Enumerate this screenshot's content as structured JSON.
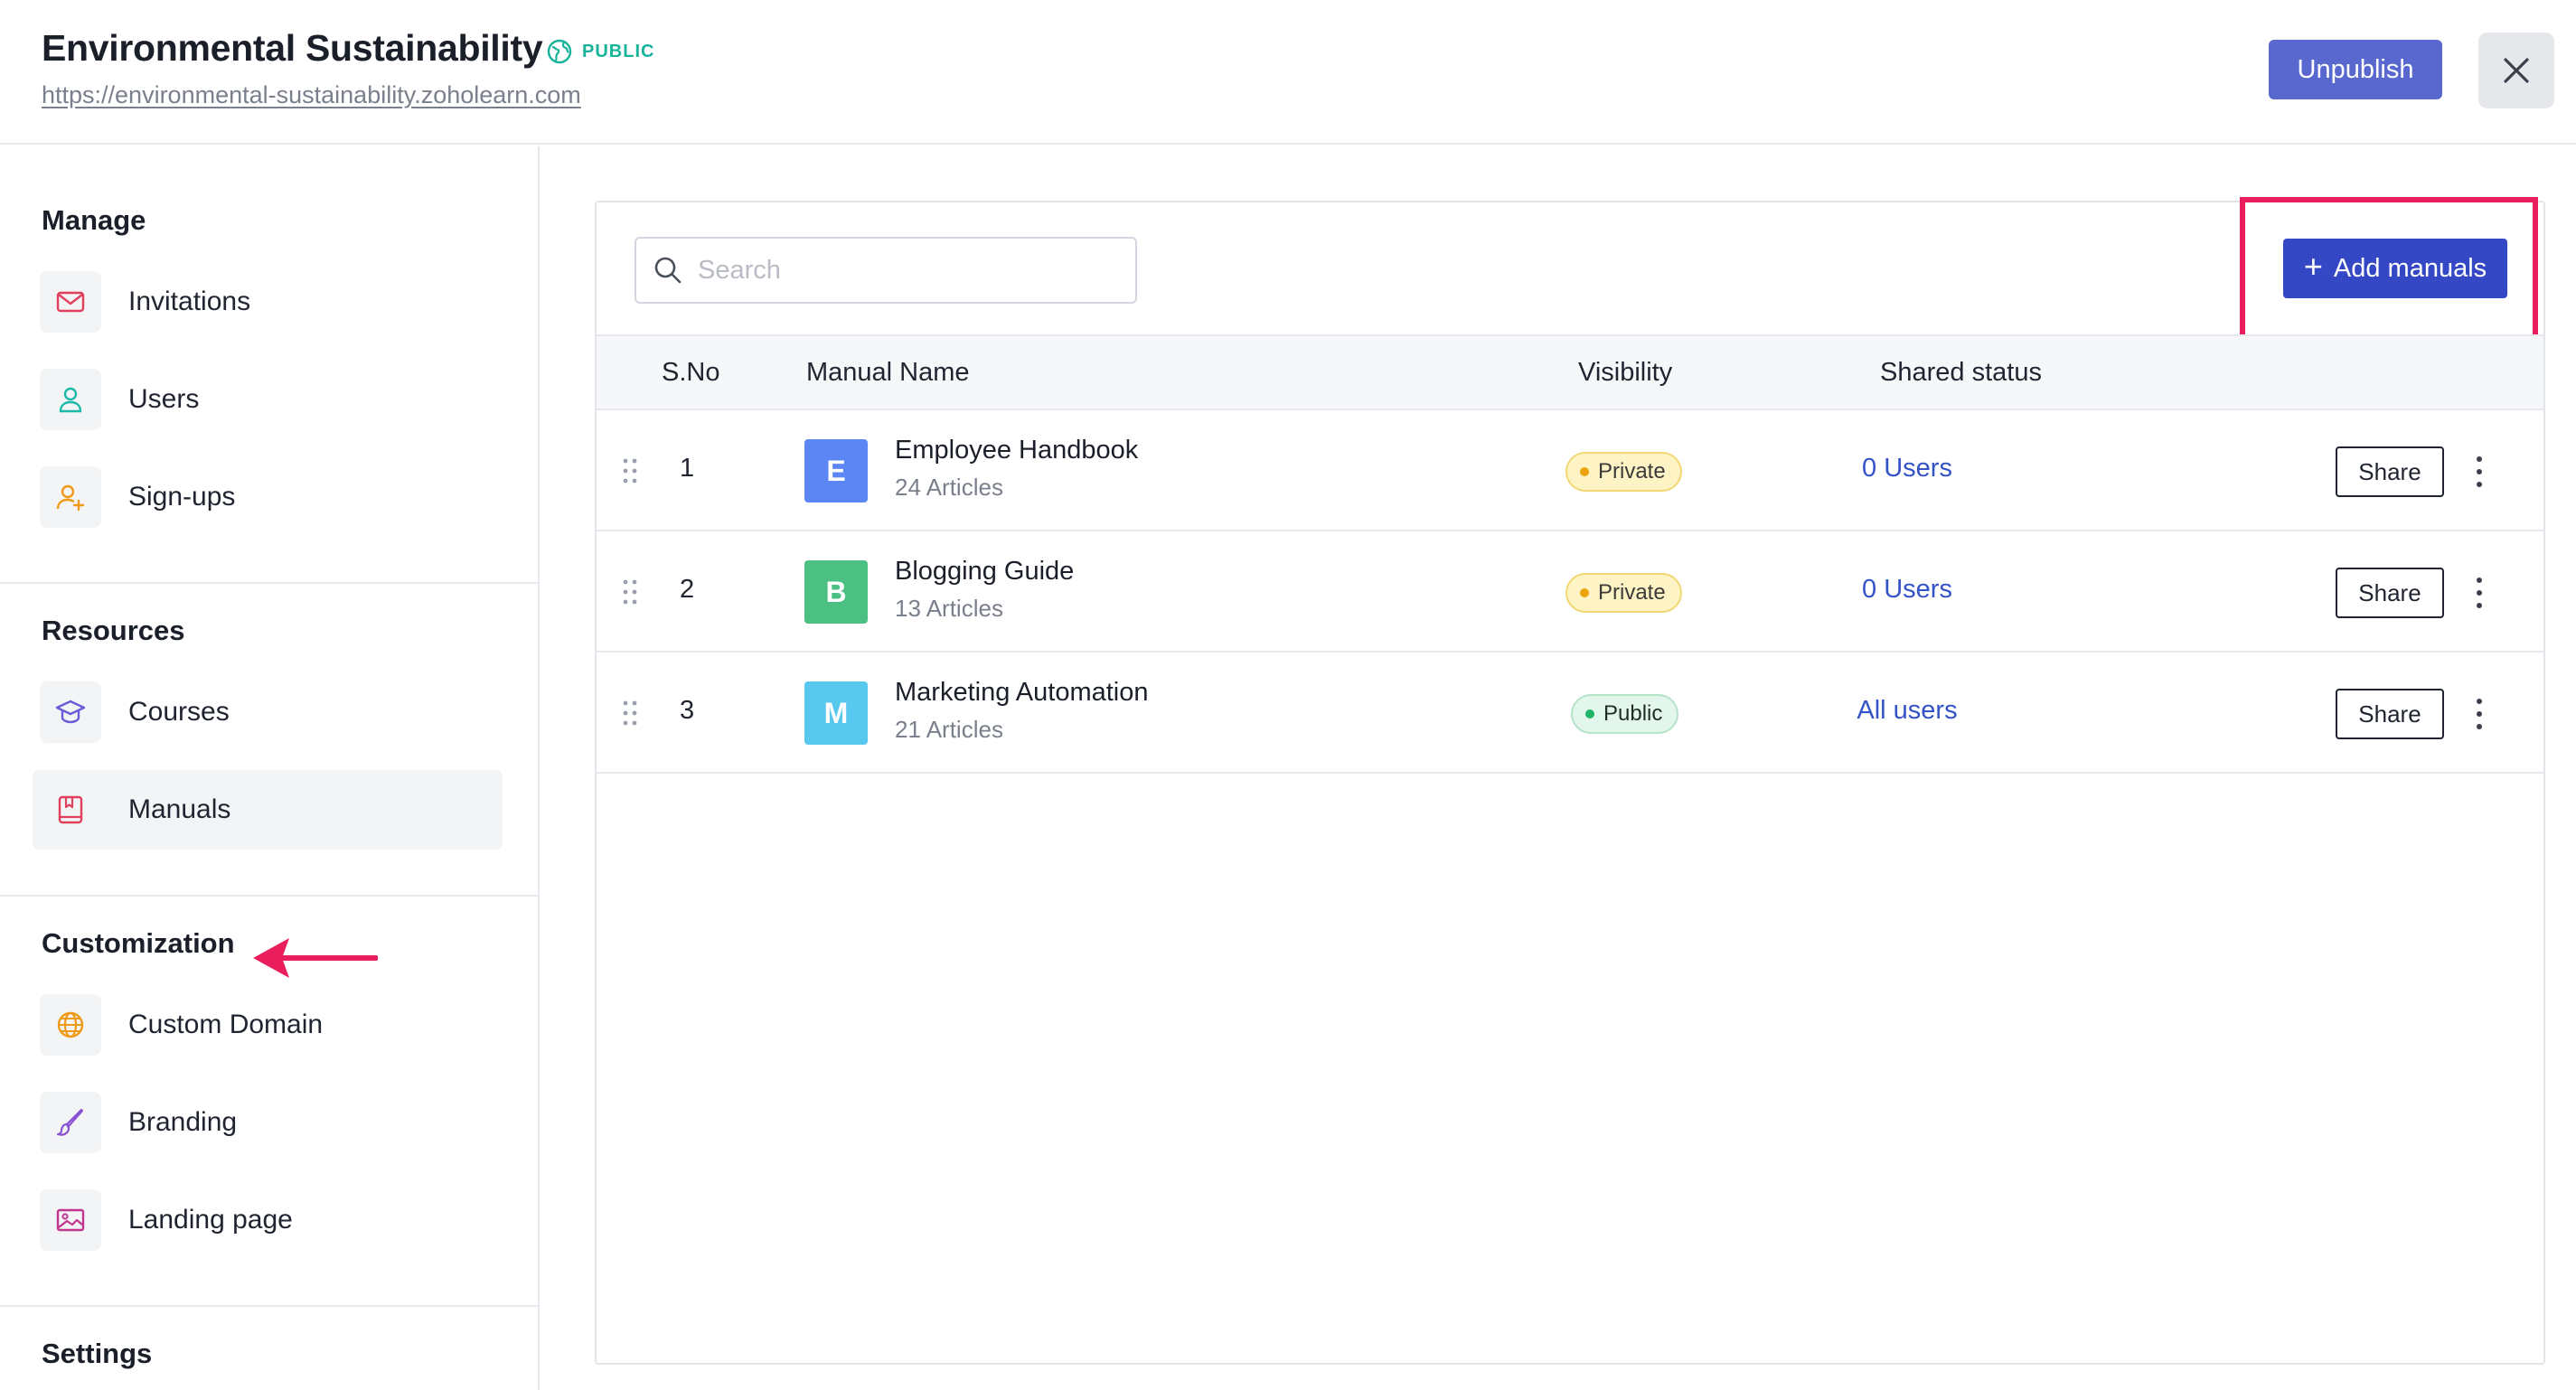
{
  "header": {
    "title": "Environmental Sustainability",
    "status": "PUBLIC",
    "url": "https://environmental-sustainability.zoholearn.com",
    "unpublish_label": "Unpublish",
    "close_icon": "close-icon"
  },
  "sidebar": {
    "manage": {
      "title": "Manage",
      "items": [
        {
          "label": "Invitations",
          "icon": "mail-icon"
        },
        {
          "label": "Users",
          "icon": "user-icon"
        },
        {
          "label": "Sign-ups",
          "icon": "user-plus-icon"
        }
      ]
    },
    "resources": {
      "title": "Resources",
      "items": [
        {
          "label": "Courses",
          "icon": "graduation-cap-icon"
        },
        {
          "label": "Manuals",
          "icon": "book-icon",
          "active": true
        }
      ]
    },
    "customization": {
      "title": "Customization",
      "items": [
        {
          "label": "Custom Domain",
          "icon": "globe-icon"
        },
        {
          "label": "Branding",
          "icon": "brush-icon"
        },
        {
          "label": "Landing page",
          "icon": "image-icon"
        }
      ]
    },
    "settings": {
      "title": "Settings"
    }
  },
  "main": {
    "search_placeholder": "Search",
    "add_button_label": "Add manuals",
    "columns": {
      "sno": "S.No",
      "name": "Manual Name",
      "visibility": "Visibility",
      "shared": "Shared status"
    },
    "rows": [
      {
        "sno": "1",
        "initial": "E",
        "avatar_color": "#5b86f3",
        "name": "Employee Handbook",
        "articles": "24 Articles",
        "visibility": "Private",
        "shared": "0 Users",
        "share_label": "Share"
      },
      {
        "sno": "2",
        "initial": "B",
        "avatar_color": "#4cbf83",
        "name": "Blogging Guide",
        "articles": "13 Articles",
        "visibility": "Private",
        "shared": "0 Users",
        "share_label": "Share"
      },
      {
        "sno": "3",
        "initial": "M",
        "avatar_color": "#58c8ee",
        "name": "Marketing Automation",
        "articles": "21 Articles",
        "visibility": "Public",
        "shared": "All users",
        "share_label": "Share"
      }
    ]
  },
  "colors": {
    "primary": "#3448c5",
    "unpublish": "#5868cf",
    "highlight": "#ea1d5d",
    "public_badge": "#18b39b",
    "link": "#3353c6"
  }
}
